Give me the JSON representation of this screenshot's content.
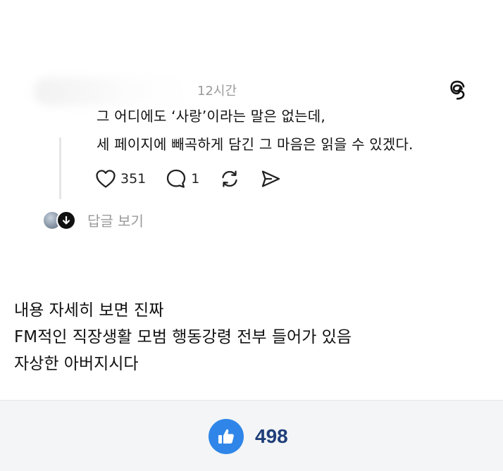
{
  "post": {
    "timestamp": "12시간",
    "lines": [
      "그 어디에도 ‘사랑’이라는 말은 없는데,",
      "세 페이지에 빼곡하게 담긴 그 마음은 읽을 수 있겠다."
    ],
    "actions": {
      "likes": "351",
      "comments": "1"
    },
    "view_replies": "답글 보기"
  },
  "caption": {
    "lines": [
      "내용 자세히 보면 진짜",
      "FM적인 직장생활 모범 행동강령 전부 들어가 있음",
      "자상한 아버지시다"
    ]
  },
  "footer": {
    "like_count": "498"
  },
  "colors": {
    "like_blue": "#2f86e8",
    "like_count_text": "#1f3f7a",
    "muted_text": "#9a9a9a",
    "footer_bg": "#f4f5f7"
  }
}
